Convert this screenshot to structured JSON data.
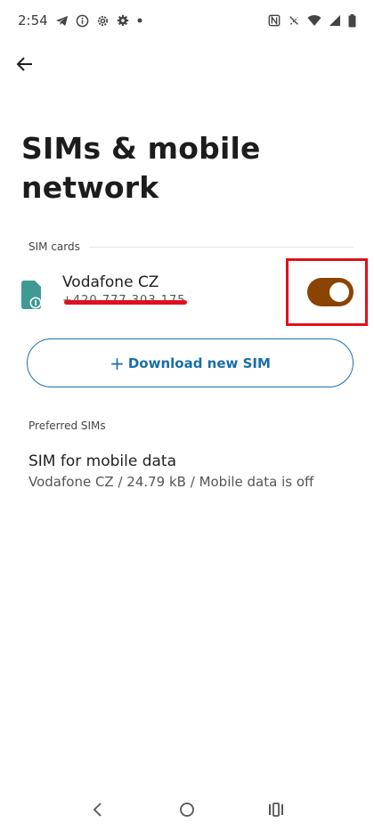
{
  "status_bar": {
    "time": "2:54",
    "icons": [
      "telegram-icon",
      "info-icon",
      "settings-icon",
      "settings-icon",
      "dot-icon",
      "nfc-icon",
      "do-not-disturb-icon",
      "wifi-icon",
      "signal-icon",
      "battery-icon"
    ]
  },
  "header": {
    "title": "SIMs & mobile network"
  },
  "sim_cards": {
    "section_label": "SIM cards",
    "sim": {
      "name": "Vodafone CZ",
      "number": "+420 777 303 175",
      "enabled": true,
      "toggle_color": "#8a4300"
    },
    "download_button_label": "Download new SIM"
  },
  "preferred_sims": {
    "section_label": "Preferred SIMs",
    "items": [
      {
        "title": "SIM for mobile data",
        "summary": "Vodafone CZ / 24.79 kB / Mobile data is off"
      }
    ]
  },
  "colors": {
    "accent": "#1a6ea8",
    "highlight": "#e0101a",
    "redaction": "#e01020"
  }
}
